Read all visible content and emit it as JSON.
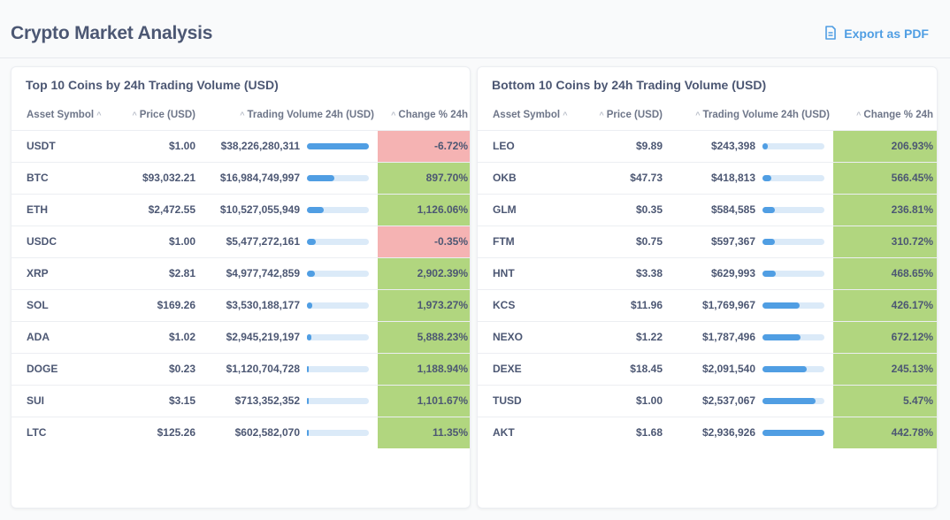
{
  "page": {
    "title": "Crypto Market Analysis",
    "export_label": "Export as PDF",
    "export_icon": "document-icon"
  },
  "colors": {
    "accent": "#509ee3",
    "positive": "#b1d67f",
    "negative": "#f5b3b3",
    "bar_track": "#dbeaf8"
  },
  "columns": {
    "symbol": "Asset Symbol",
    "price": "Price (USD)",
    "volume": "Trading Volume 24h (USD)",
    "change": "Change % 24h"
  },
  "top_table": {
    "title": "Top 10 Coins by 24h Trading Volume (USD)",
    "rows": [
      {
        "symbol": "USDT",
        "price": "$1.00",
        "volume": "$38,226,280,311",
        "volume_share": 1.0,
        "change": "-6.72%",
        "sign": "neg"
      },
      {
        "symbol": "BTC",
        "price": "$93,032.21",
        "volume": "$16,984,749,997",
        "volume_share": 0.444,
        "change": "897.70%",
        "sign": "pos"
      },
      {
        "symbol": "ETH",
        "price": "$2,472.55",
        "volume": "$10,527,055,949",
        "volume_share": 0.275,
        "change": "1,126.06%",
        "sign": "pos"
      },
      {
        "symbol": "USDC",
        "price": "$1.00",
        "volume": "$5,477,272,161",
        "volume_share": 0.143,
        "change": "-0.35%",
        "sign": "neg"
      },
      {
        "symbol": "XRP",
        "price": "$2.81",
        "volume": "$4,977,742,859",
        "volume_share": 0.13,
        "change": "2,902.39%",
        "sign": "pos"
      },
      {
        "symbol": "SOL",
        "price": "$169.26",
        "volume": "$3,530,188,177",
        "volume_share": 0.092,
        "change": "1,973.27%",
        "sign": "pos"
      },
      {
        "symbol": "ADA",
        "price": "$1.02",
        "volume": "$2,945,219,197",
        "volume_share": 0.077,
        "change": "5,888.23%",
        "sign": "pos"
      },
      {
        "symbol": "DOGE",
        "price": "$0.23",
        "volume": "$1,120,704,728",
        "volume_share": 0.029,
        "change": "1,188.94%",
        "sign": "pos"
      },
      {
        "symbol": "SUI",
        "price": "$3.15",
        "volume": "$713,352,352",
        "volume_share": 0.019,
        "change": "1,101.67%",
        "sign": "pos"
      },
      {
        "symbol": "LTC",
        "price": "$125.26",
        "volume": "$602,582,070",
        "volume_share": 0.016,
        "change": "11.35%",
        "sign": "pos"
      }
    ]
  },
  "bottom_table": {
    "title": "Bottom 10 Coins by 24h Trading Volume (USD)",
    "rows": [
      {
        "symbol": "LEO",
        "price": "$9.89",
        "volume": "$243,398",
        "volume_share": 0.083,
        "change": "206.93%",
        "sign": "pos"
      },
      {
        "symbol": "OKB",
        "price": "$47.73",
        "volume": "$418,813",
        "volume_share": 0.143,
        "change": "566.45%",
        "sign": "pos"
      },
      {
        "symbol": "GLM",
        "price": "$0.35",
        "volume": "$584,585",
        "volume_share": 0.199,
        "change": "236.81%",
        "sign": "pos"
      },
      {
        "symbol": "FTM",
        "price": "$0.75",
        "volume": "$597,367",
        "volume_share": 0.203,
        "change": "310.72%",
        "sign": "pos"
      },
      {
        "symbol": "HNT",
        "price": "$3.38",
        "volume": "$629,993",
        "volume_share": 0.215,
        "change": "468.65%",
        "sign": "pos"
      },
      {
        "symbol": "KCS",
        "price": "$11.96",
        "volume": "$1,769,967",
        "volume_share": 0.603,
        "change": "426.17%",
        "sign": "pos"
      },
      {
        "symbol": "NEXO",
        "price": "$1.22",
        "volume": "$1,787,496",
        "volume_share": 0.609,
        "change": "672.12%",
        "sign": "pos"
      },
      {
        "symbol": "DEXE",
        "price": "$18.45",
        "volume": "$2,091,540",
        "volume_share": 0.712,
        "change": "245.13%",
        "sign": "pos"
      },
      {
        "symbol": "TUSD",
        "price": "$1.00",
        "volume": "$2,537,067",
        "volume_share": 0.864,
        "change": "5.47%",
        "sign": "pos"
      },
      {
        "symbol": "AKT",
        "price": "$1.68",
        "volume": "$2,936,926",
        "volume_share": 1.0,
        "change": "442.78%",
        "sign": "pos"
      }
    ]
  }
}
